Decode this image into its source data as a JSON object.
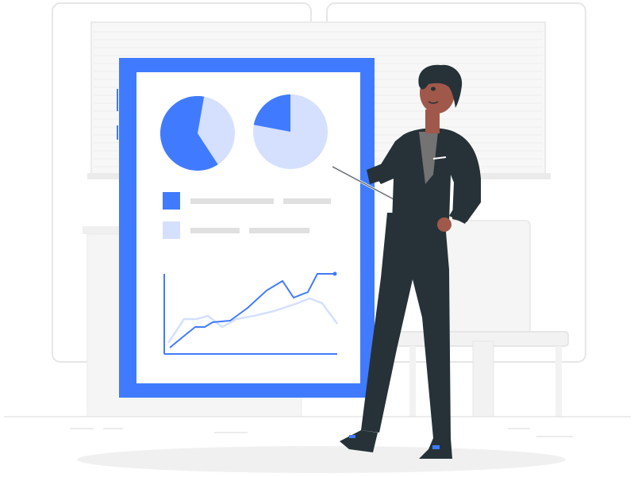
{
  "colors": {
    "accent": "#407BFF",
    "accent_light": "#D5E0FF",
    "bar_gray": "#E0E0E0",
    "outline_gray": "#E6E6E6",
    "suit": "#263238",
    "skin": "#A0584A",
    "hair": "#263238",
    "shirt": "#737373",
    "shadow": "#F0F0F0",
    "blind": "#F2F2F2"
  },
  "illustration": {
    "board": {
      "pie_left_fraction": 0.62,
      "pie_right_fraction": 0.22
    }
  }
}
